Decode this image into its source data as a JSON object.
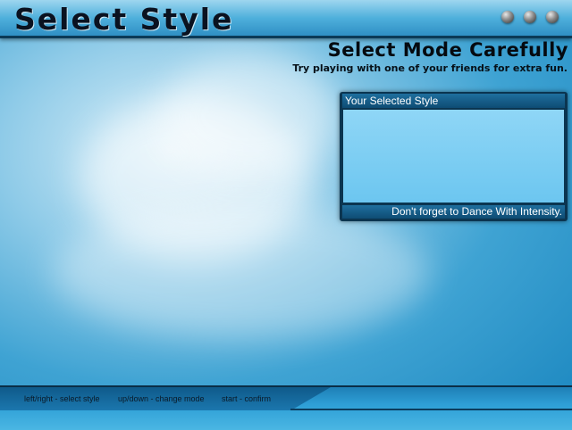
{
  "header": {
    "title": "Select Style"
  },
  "mode": {
    "title": "Select Mode Carefully",
    "subtitle": "Try playing with one of your friends for extra fun."
  },
  "panel": {
    "heading": "Your Selected Style",
    "footer": "Don't forget to Dance With Intensity."
  },
  "footer": {
    "hints": [
      "left/right - select style",
      "up/down - change mode",
      "start - confirm"
    ]
  },
  "colors": {
    "accent": "#2f8fc4",
    "panel_dark": "#0b3550",
    "panel_body": "#8fd6f6"
  }
}
